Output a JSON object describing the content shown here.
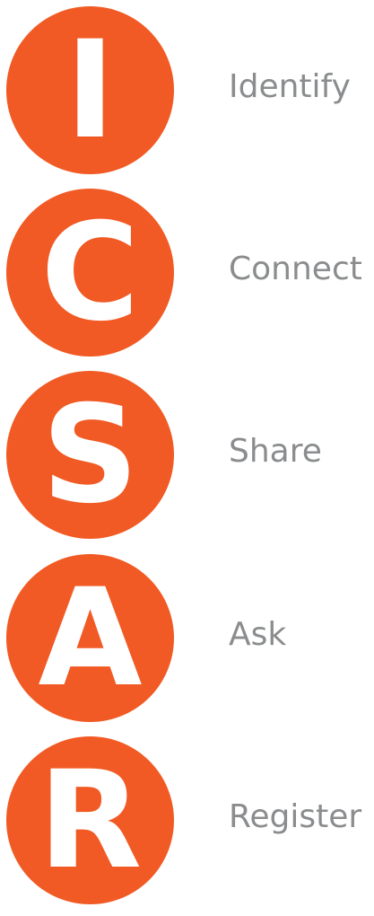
{
  "colors": {
    "circle": "#f15a24",
    "letter": "#ffffff",
    "label": "#8a8c8e"
  },
  "steps": [
    {
      "letter": "I",
      "label": "Identify"
    },
    {
      "letter": "C",
      "label": "Connect"
    },
    {
      "letter": "S",
      "label": "Share"
    },
    {
      "letter": "A",
      "label": "Ask"
    },
    {
      "letter": "R",
      "label": "Register"
    }
  ]
}
